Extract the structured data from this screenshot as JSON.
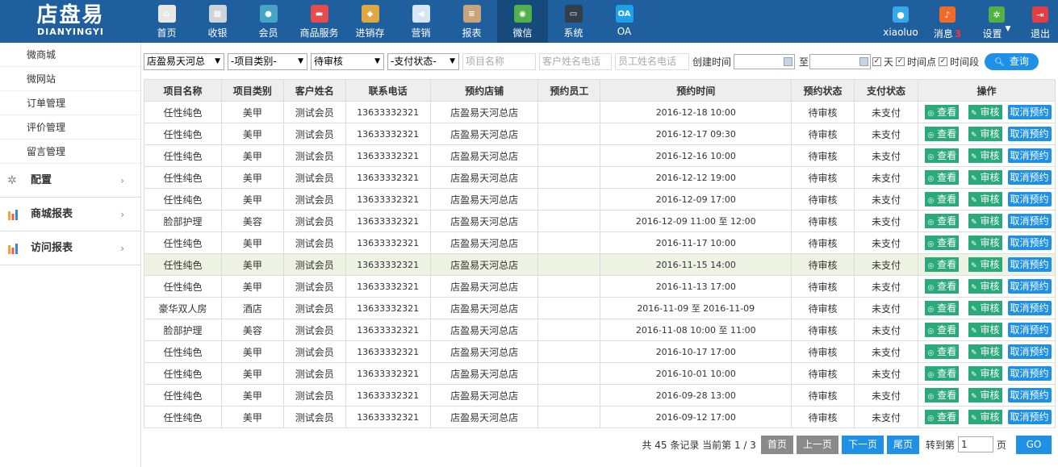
{
  "logo": {
    "cn": "店盘易",
    "en": "DIANYINGYI"
  },
  "nav": [
    {
      "label": "首页",
      "icon": "home-icon",
      "color": "#e8e8e8",
      "glyph": "⌂"
    },
    {
      "label": "收银",
      "icon": "cash-register-icon",
      "color": "#cfd4da",
      "glyph": "▦"
    },
    {
      "label": "会员",
      "icon": "member-icon",
      "color": "#45a5c4",
      "glyph": "●"
    },
    {
      "label": "商品服务",
      "icon": "product-icon",
      "color": "#e74b4b",
      "glyph": "▬"
    },
    {
      "label": "进销存",
      "icon": "inventory-icon",
      "color": "#e0a840",
      "glyph": "◆"
    },
    {
      "label": "营销",
      "icon": "megaphone-icon",
      "color": "#d7e6f5",
      "glyph": "◀"
    },
    {
      "label": "报表",
      "icon": "report-icon",
      "color": "#c8a47a",
      "glyph": "≡"
    },
    {
      "label": "微信",
      "icon": "wechat-icon",
      "color": "#52b24a",
      "glyph": "◉"
    },
    {
      "label": "系统",
      "icon": "system-monitor-icon",
      "color": "#333e4c",
      "glyph": "▭"
    },
    {
      "label": "OA",
      "icon": "oa-icon",
      "color": "#1ea1e8",
      "glyph": "OA"
    }
  ],
  "right_nav": {
    "user": "xiaoluo",
    "message_label": "消息",
    "message_count": "3",
    "settings_label": "设置",
    "logout_label": "退出"
  },
  "sidebar": {
    "sub_items": [
      "微商城",
      "微网站",
      "订单管理",
      "评价管理",
      "留言管理"
    ],
    "groups": [
      "配置",
      "商城报表",
      "访问报表"
    ]
  },
  "filters": {
    "store": "店盈易天河总",
    "category": "-项目类别-",
    "status": "待审核",
    "pay_status": "-支付状态-",
    "project_placeholder": "项目名称",
    "customer_placeholder": "客户姓名电话",
    "staff_placeholder": "员工姓名电话",
    "created_label": "创建时间",
    "to_label": "至",
    "day_label": "天",
    "timepoint_label": "时间点",
    "timerange_label": "时间段",
    "query_label": "查询"
  },
  "table": {
    "headers": [
      "项目名称",
      "项目类别",
      "客户姓名",
      "联系电话",
      "预约店铺",
      "预约员工",
      "预约时间",
      "预约状态",
      "支付状态",
      "操作"
    ],
    "actions": {
      "view": "查看",
      "audit": "审核",
      "cancel": "取消预约"
    },
    "rows": [
      [
        "任性纯色",
        "美甲",
        "测试会员",
        "13633332321",
        "店盈易天河总店",
        "",
        "2016-12-18 10:00",
        "待审核",
        "未支付"
      ],
      [
        "任性纯色",
        "美甲",
        "测试会员",
        "13633332321",
        "店盈易天河总店",
        "",
        "2016-12-17 09:30",
        "待审核",
        "未支付"
      ],
      [
        "任性纯色",
        "美甲",
        "测试会员",
        "13633332321",
        "店盈易天河总店",
        "",
        "2016-12-16 10:00",
        "待审核",
        "未支付"
      ],
      [
        "任性纯色",
        "美甲",
        "测试会员",
        "13633332321",
        "店盈易天河总店",
        "",
        "2016-12-12 19:00",
        "待审核",
        "未支付"
      ],
      [
        "任性纯色",
        "美甲",
        "测试会员",
        "13633332321",
        "店盈易天河总店",
        "",
        "2016-12-09 17:00",
        "待审核",
        "未支付"
      ],
      [
        "脸部护理",
        "美容",
        "测试会员",
        "13633332321",
        "店盈易天河总店",
        "",
        "2016-12-09 11:00 至 12:00",
        "待审核",
        "未支付"
      ],
      [
        "任性纯色",
        "美甲",
        "测试会员",
        "13633332321",
        "店盈易天河总店",
        "",
        "2016-11-17 10:00",
        "待审核",
        "未支付"
      ],
      [
        "任性纯色",
        "美甲",
        "测试会员",
        "13633332321",
        "店盈易天河总店",
        "",
        "2016-11-15 14:00",
        "待审核",
        "未支付"
      ],
      [
        "任性纯色",
        "美甲",
        "测试会员",
        "13633332321",
        "店盈易天河总店",
        "",
        "2016-11-13 17:00",
        "待审核",
        "未支付"
      ],
      [
        "豪华双人房",
        "酒店",
        "测试会员",
        "13633332321",
        "店盈易天河总店",
        "",
        "2016-11-09 至 2016-11-09",
        "待审核",
        "未支付"
      ],
      [
        "脸部护理",
        "美容",
        "测试会员",
        "13633332321",
        "店盈易天河总店",
        "",
        "2016-11-08 10:00 至 11:00",
        "待审核",
        "未支付"
      ],
      [
        "任性纯色",
        "美甲",
        "测试会员",
        "13633332321",
        "店盈易天河总店",
        "",
        "2016-10-17 17:00",
        "待审核",
        "未支付"
      ],
      [
        "任性纯色",
        "美甲",
        "测试会员",
        "13633332321",
        "店盈易天河总店",
        "",
        "2016-10-01 10:00",
        "待审核",
        "未支付"
      ],
      [
        "任性纯色",
        "美甲",
        "测试会员",
        "13633332321",
        "店盈易天河总店",
        "",
        "2016-09-28 13:00",
        "待审核",
        "未支付"
      ],
      [
        "任性纯色",
        "美甲",
        "测试会员",
        "13633332321",
        "店盈易天河总店",
        "",
        "2016-09-12 17:00",
        "待审核",
        "未支付"
      ]
    ]
  },
  "pager": {
    "summary": "共 45 条记录 当前第 1 / 3",
    "first": "首页",
    "prev": "上一页",
    "next": "下一页",
    "last": "尾页",
    "goto_label": "转到第",
    "page_value": "1",
    "page_unit": "页",
    "go": "GO"
  }
}
